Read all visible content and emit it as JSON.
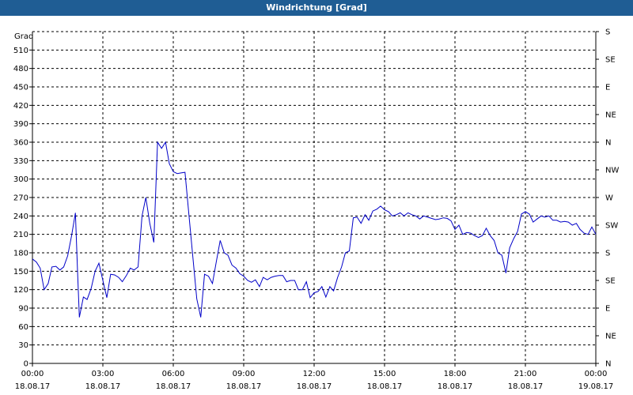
{
  "window": {
    "title": "Windrichtung [Grad]"
  },
  "chart_data": {
    "type": "line",
    "title": "Windrichtung [Grad]",
    "ylabel": "Grad",
    "ylim": [
      0,
      540
    ],
    "y_ticks": [
      0,
      30,
      60,
      90,
      120,
      150,
      180,
      210,
      240,
      270,
      300,
      330,
      360,
      390,
      420,
      450,
      480,
      510
    ],
    "right_axis_labels": [
      "N",
      "NE",
      "E",
      "SE",
      "S",
      "SW",
      "W",
      "NW",
      "N",
      "NE",
      "E",
      "SE",
      "S"
    ],
    "xlim": [
      0,
      24
    ],
    "x_ticks": [
      {
        "value": 0,
        "time": "00:00",
        "date": "18.08.17"
      },
      {
        "value": 3,
        "time": "03:00",
        "date": "18.08.17"
      },
      {
        "value": 6,
        "time": "06:00",
        "date": "18.08.17"
      },
      {
        "value": 9,
        "time": "09:00",
        "date": "18.08.17"
      },
      {
        "value": 12,
        "time": "12:00",
        "date": "18.08.17"
      },
      {
        "value": 15,
        "time": "15:00",
        "date": "18.08.17"
      },
      {
        "value": 18,
        "time": "18:00",
        "date": "18.08.17"
      },
      {
        "value": 21,
        "time": "21:00",
        "date": "18.08.17"
      },
      {
        "value": 24,
        "time": "00:00",
        "date": "19.08.17"
      }
    ],
    "grid": true,
    "line_color": "#0000c8",
    "series": [
      {
        "name": "",
        "x": [
          0.0,
          0.17,
          0.33,
          0.5,
          0.67,
          0.83,
          1.0,
          1.17,
          1.33,
          1.5,
          1.67,
          1.83,
          1.92,
          2.0,
          2.17,
          2.33,
          2.5,
          2.67,
          2.83,
          3.0,
          3.17,
          3.33,
          3.5,
          3.67,
          3.83,
          4.0,
          4.17,
          4.33,
          4.5,
          4.67,
          4.83,
          5.0,
          5.17,
          5.33,
          5.5,
          5.67,
          5.83,
          6.0,
          6.17,
          6.33,
          6.5,
          6.67,
          6.83,
          7.0,
          7.17,
          7.33,
          7.5,
          7.67,
          7.83,
          8.0,
          8.17,
          8.33,
          8.5,
          8.67,
          8.83,
          9.0,
          9.17,
          9.33,
          9.5,
          9.67,
          9.83,
          10.0,
          10.17,
          10.33,
          10.5,
          10.67,
          10.83,
          11.0,
          11.17,
          11.33,
          11.5,
          11.67,
          11.83,
          12.0,
          12.17,
          12.33,
          12.5,
          12.67,
          12.83,
          13.0,
          13.17,
          13.33,
          13.5,
          13.67,
          13.83,
          14.0,
          14.17,
          14.33,
          14.5,
          14.67,
          14.83,
          15.0,
          15.17,
          15.33,
          15.5,
          15.67,
          15.83,
          16.0,
          16.17,
          16.33,
          16.5,
          16.67,
          16.83,
          17.0,
          17.17,
          17.33,
          17.5,
          17.67,
          17.83,
          18.0,
          18.17,
          18.33,
          18.5,
          18.67,
          18.83,
          19.0,
          19.17,
          19.33,
          19.5,
          19.67,
          19.83,
          20.0,
          20.17,
          20.33,
          20.5,
          20.67,
          20.83,
          21.0,
          21.17,
          21.33,
          21.5,
          21.67,
          21.83,
          22.0,
          22.17,
          22.33,
          22.5,
          22.67,
          22.83,
          23.0,
          23.17,
          23.33,
          23.5,
          23.67,
          23.83,
          24.0
        ],
        "y": [
          170,
          165,
          155,
          120,
          130,
          157,
          158,
          152,
          157,
          175,
          208,
          245,
          150,
          75,
          108,
          104,
          122,
          150,
          163,
          135,
          107,
          145,
          144,
          140,
          133,
          143,
          155,
          152,
          157,
          240,
          270,
          228,
          197,
          360,
          350,
          360,
          325,
          312,
          309,
          310,
          311,
          240,
          175,
          105,
          75,
          145,
          142,
          130,
          165,
          200,
          180,
          176,
          160,
          155,
          146,
          142,
          135,
          132,
          136,
          125,
          140,
          136,
          140,
          142,
          143,
          143,
          133,
          135,
          135,
          120,
          120,
          133,
          107,
          115,
          117,
          125,
          108,
          125,
          118,
          140,
          157,
          180,
          183,
          237,
          238,
          228,
          242,
          233,
          248,
          251,
          256,
          250,
          247,
          240,
          242,
          245,
          240,
          245,
          242,
          240,
          235,
          240,
          238,
          236,
          234,
          235,
          237,
          236,
          232,
          218,
          225,
          210,
          213,
          212,
          208,
          205,
          208,
          220,
          208,
          200,
          180,
          176,
          147,
          188,
          203,
          215,
          243,
          247,
          243,
          230,
          235,
          240,
          238,
          240,
          233,
          233,
          230,
          231,
          230,
          225,
          228,
          218,
          212,
          210,
          222,
          210
        ]
      }
    ]
  }
}
